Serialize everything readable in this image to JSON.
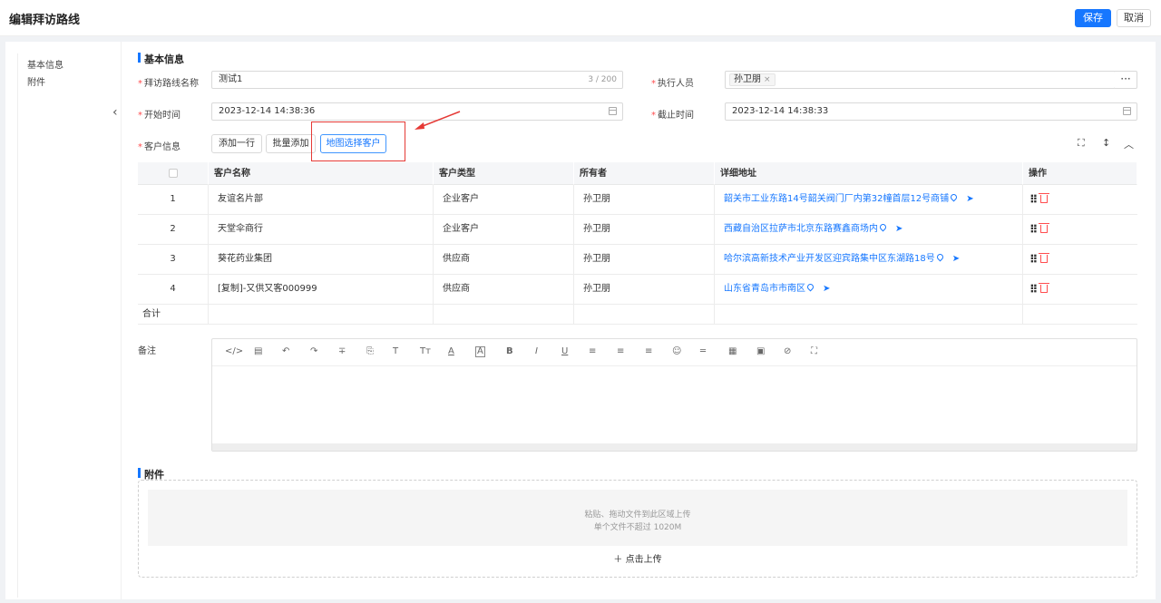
{
  "header": {
    "title": "编辑拜访路线",
    "save_label": "保存",
    "cancel_label": "取消"
  },
  "nav": {
    "items": [
      "基本信息",
      "附件"
    ]
  },
  "basic": {
    "section_title": "基本信息",
    "route_name_label": "拜访路线名称",
    "route_name_value": "测试1",
    "route_name_counter": "3 / 200",
    "executor_label": "执行人员",
    "executor_tag": "孙卫朋",
    "more_label": "···",
    "start_label": "开始时间",
    "start_value": "2023-12-14 14:38:36",
    "end_label": "截止时间",
    "end_value": "2023-12-14 14:38:33",
    "customer_label": "客户信息",
    "add_row_label": "添加一行",
    "batch_add_label": "批量添加",
    "map_select_label": "地图选择客户"
  },
  "table": {
    "headers": [
      "客户名称",
      "客户类型",
      "所有者",
      "详细地址",
      "操作"
    ],
    "rows": [
      {
        "idx": "1",
        "name": "友谊名片部",
        "type": "企业客户",
        "owner": "孙卫朋",
        "addr": "韶关市工业东路14号韶关阀门厂内第32幢首层12号商铺"
      },
      {
        "idx": "2",
        "name": "天堂伞商行",
        "type": "企业客户",
        "owner": "孙卫朋",
        "addr": "西藏自治区拉萨市北京东路赛鑫商场内"
      },
      {
        "idx": "3",
        "name": "葵花药业集团",
        "type": "供应商",
        "owner": "孙卫朋",
        "addr": "哈尔滨高新技术产业开发区迎宾路集中区东湖路18号"
      },
      {
        "idx": "4",
        "name": "[复制]-又供又客000999",
        "type": "供应商",
        "owner": "孙卫朋",
        "addr": "山东省青岛市市南区"
      }
    ],
    "total_label": "合计"
  },
  "remark": {
    "label": "备注"
  },
  "attachment": {
    "section_title": "附件",
    "drop_line1": "粘贴、拖动文件到此区域上传",
    "drop_line2": "单个文件不超过 1020M",
    "upload_label": "点击上传"
  },
  "colors": {
    "primary": "#1677ff",
    "danger": "#ff4d4f",
    "highlight_box": "#e53935"
  }
}
